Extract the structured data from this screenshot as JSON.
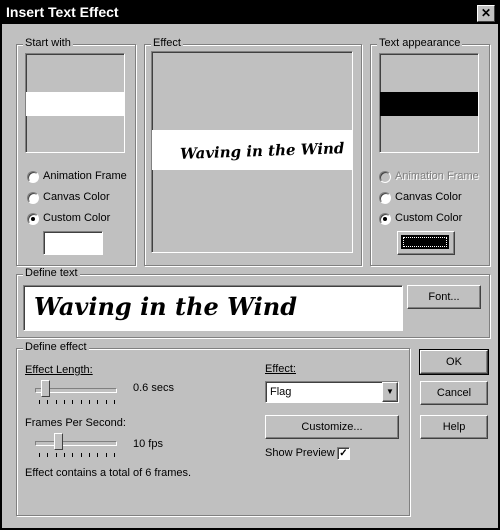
{
  "window": {
    "title": "Insert Text Effect",
    "close_glyph": "✕"
  },
  "start_with": {
    "label": "Start with",
    "options": [
      "Animation Frame",
      "Canvas Color",
      "Custom Color"
    ],
    "selected": "Custom Color",
    "custom_color": "#ffffff"
  },
  "effect_preview": {
    "label": "Effect",
    "preview_text": "Waving in the Wind"
  },
  "text_appearance": {
    "label": "Text appearance",
    "options": [
      "Animation Frame",
      "Canvas Color",
      "Custom Color"
    ],
    "selected": "Custom Color",
    "disabled": [
      "Animation Frame"
    ],
    "custom_color": "#000000"
  },
  "define_text": {
    "label": "Define text",
    "value": "Waving in the Wind",
    "font_button": "Font..."
  },
  "define_effect": {
    "label": "Define effect",
    "effect_length_label": "Effect Length:",
    "effect_length_value": "0.6 secs",
    "effect_length_fraction": 0.08,
    "fps_label": "Frames Per Second:",
    "fps_value": "10 fps",
    "fps_fraction": 0.27,
    "summary": "Effect contains a total of 6 frames.",
    "effect_label": "Effect:",
    "effect_selected": "Flag",
    "customize_button": "Customize...",
    "show_preview_label": "Show Preview",
    "show_preview_checked": true
  },
  "buttons": {
    "ok": "OK",
    "cancel": "Cancel",
    "help": "Help"
  },
  "colors": {
    "dialog_face": "#c0c0c0",
    "title_bar": "#000000",
    "preview_canvas": "#ffffff"
  }
}
